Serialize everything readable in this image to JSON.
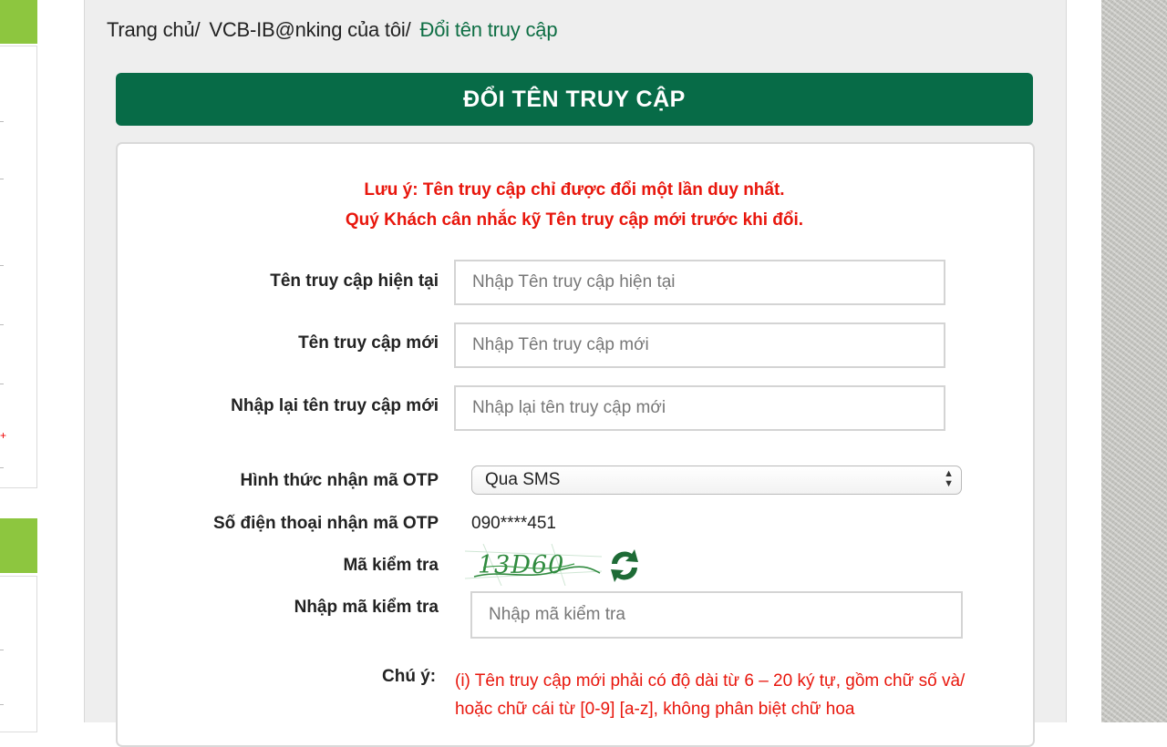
{
  "breadcrumb": {
    "home": "Trang chủ",
    "my_banking": "VCB-IB@nking của tôi",
    "current": "Đổi tên truy cập",
    "separator": "/"
  },
  "page_title": "ĐỔI TÊN TRUY CẬP",
  "notice": {
    "line1": "Lưu ý: Tên truy cập chỉ được đổi một lần duy nhất.",
    "line2": "Quý Khách cân nhắc kỹ Tên truy cập mới trước khi đổi."
  },
  "form": {
    "current_username_label": "Tên truy cập hiện tại",
    "current_username_placeholder": "Nhập Tên truy cập hiện tại",
    "new_username_label": "Tên truy cập mới",
    "new_username_placeholder": "Nhập Tên truy cập mới",
    "confirm_username_label": "Nhập lại tên truy cập mới",
    "confirm_username_placeholder": "Nhập lại tên truy cập mới",
    "otp_method_label": "Hình thức nhận mã OTP",
    "otp_method_value": "Qua SMS",
    "otp_phone_label": "Số điện thoại nhận mã OTP",
    "otp_phone_value": "090****451",
    "captcha_label": "Mã kiểm tra",
    "captcha_image_text": "13D60",
    "captcha_input_label": "Nhập mã kiểm tra",
    "captcha_input_placeholder": "Nhập mã kiểm tra"
  },
  "note": {
    "label": "Chú ý:",
    "text": "(i) Tên truy cập mới phải có độ dài từ 6 – 20 ký tự, gồm chữ số và/ hoặc chữ cái từ [0-9] [a-z], không phân biệt chữ hoa"
  },
  "colors": {
    "brand_green": "#076b47",
    "accent_light_green": "#8dc63f",
    "warning_red": "#e8160c"
  }
}
